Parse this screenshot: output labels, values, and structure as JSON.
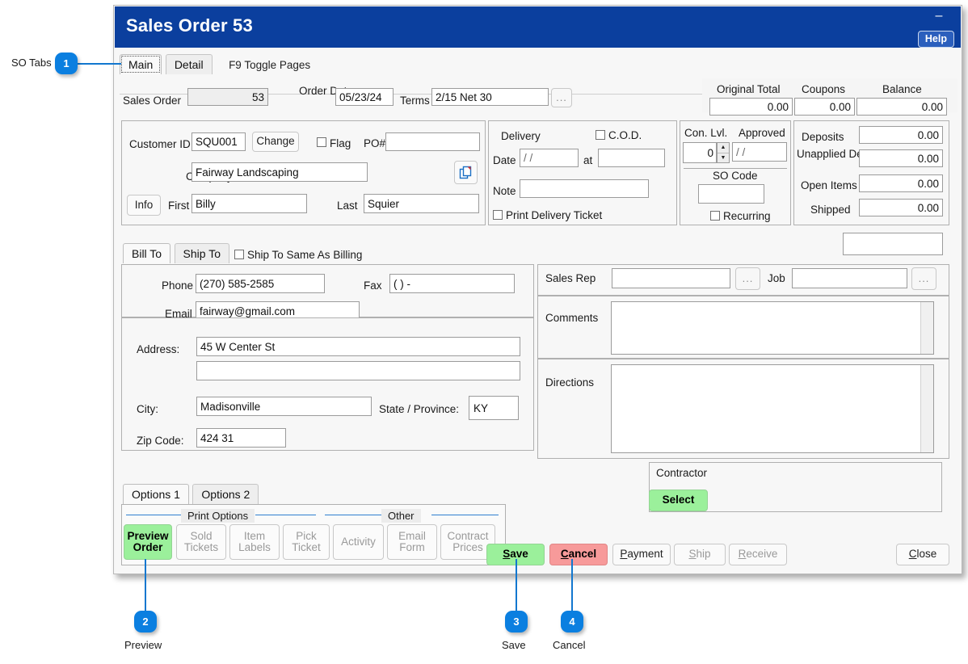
{
  "window": {
    "title": "Sales Order 53",
    "minimize_label": "–",
    "help_label": "Help"
  },
  "tabs": {
    "items": [
      {
        "label": "Main",
        "active": true
      },
      {
        "label": "Detail",
        "active": false
      }
    ],
    "hint": "F9 Toggle Pages"
  },
  "header": {
    "sales_order_label": "Sales Order",
    "sales_order_value": "53",
    "order_date_label": "Order Date",
    "order_date_value": "05/23/24",
    "terms_label": "Terms",
    "terms_value": "2/15 Net 30",
    "terms_browse_label": "...",
    "totals": [
      {
        "label": "Original Total",
        "value": "0.00"
      },
      {
        "label": "Coupons",
        "value": "0.00"
      },
      {
        "label": "Balance",
        "value": "0.00"
      }
    ]
  },
  "customer": {
    "customer_id_label": "Customer ID",
    "customer_id_value": "SQU001",
    "change_label": "Change",
    "flag_label": "Flag",
    "flag_checked": false,
    "po_label": "PO#",
    "po_value": "",
    "company_label": "Company",
    "company_value": "Fairway Landscaping",
    "copy_icon": "copy-icon",
    "info_label": "Info",
    "first_label": "First",
    "first_value": "Billy",
    "last_label": "Last",
    "last_value": "Squier"
  },
  "delivery": {
    "title": "Delivery",
    "cod_label": "C.O.D.",
    "cod_checked": false,
    "date_label": "Date",
    "date_value": "/  /",
    "at_label": "at",
    "at_value": "",
    "note_label": "Note",
    "note_value": "",
    "print_ticket_label": "Print Delivery Ticket",
    "print_ticket_checked": false
  },
  "control": {
    "con_lvl_label": "Con. Lvl.",
    "con_lvl_value": "0",
    "approved_label": "Approved",
    "approved_value": "/  /",
    "so_code_label": "SO Code",
    "so_code_value": "",
    "recurring_label": "Recurring",
    "recurring_checked": false
  },
  "amounts": [
    {
      "label": "Deposits",
      "value": "0.00"
    },
    {
      "label": "Unapplied Deposits",
      "value": "0.00"
    },
    {
      "label": "Open Items",
      "value": "0.00"
    },
    {
      "label": "Shipped",
      "value": "0.00"
    }
  ],
  "status_dropdown": {
    "value": "",
    "icon": "chevron-down-icon"
  },
  "billship": {
    "tabs": [
      {
        "label": "Bill To",
        "active": true
      },
      {
        "label": "Ship To",
        "active": false
      }
    ],
    "same_as_billing_label": "Ship To Same As Billing",
    "same_as_billing_checked": false,
    "phone_label": "Phone",
    "phone_value": "(270) 585-2585",
    "fax_label": "Fax",
    "fax_value": "(    )      -",
    "email_label": "Email",
    "email_value": "fairway@gmail.com",
    "address_label": "Address:",
    "address_value": "45 W Center St",
    "address2_value": "",
    "city_label": "City:",
    "city_value": "Madisonville",
    "state_label": "State / Province:",
    "state_value": "KY",
    "state_icon": "chevron-down-icon",
    "zip_label": "Zip Code:",
    "zip_value": "424 31"
  },
  "rightpanel": {
    "sales_rep_label": "Sales Rep",
    "sales_rep_value": "",
    "sales_rep_browse_label": "...",
    "job_label": "Job",
    "job_value": "",
    "job_browse_label": "...",
    "comments_label": "Comments",
    "comments_value": "",
    "directions_label": "Directions",
    "directions_value": ""
  },
  "contractor": {
    "title": "Contractor",
    "select_label": "Select"
  },
  "options": {
    "tabs": [
      {
        "label": "Options 1",
        "active": true
      },
      {
        "label": "Options 2",
        "active": false
      }
    ],
    "groups": [
      {
        "caption": "Print Options"
      },
      {
        "caption": "Other"
      }
    ],
    "buttons": [
      {
        "line1": "Preview",
        "line2": "Order",
        "state": "green"
      },
      {
        "line1": "Sold",
        "line2": "Tickets",
        "state": "disabled"
      },
      {
        "line1": "Item",
        "line2": "Labels",
        "state": "disabled"
      },
      {
        "line1": "Pick",
        "line2": "Ticket",
        "state": "disabled"
      },
      {
        "line1": "Activity",
        "line2": "",
        "state": "disabled"
      },
      {
        "line1": "Email",
        "line2": "Form",
        "state": "disabled"
      },
      {
        "line1": "Contract",
        "line2": "Prices",
        "state": "disabled"
      }
    ]
  },
  "actions": [
    {
      "accel": "S",
      "rest": "ave",
      "state": "green"
    },
    {
      "accel": "C",
      "rest": "ancel",
      "state": "red"
    },
    {
      "accel": "P",
      "rest": "ayment",
      "state": "normal"
    },
    {
      "accel": "S",
      "rest": "hip",
      "state": "disabled"
    },
    {
      "accel": "R",
      "rest": "eceive",
      "state": "disabled"
    },
    {
      "accel": "C",
      "rest": "lose",
      "state": "normal"
    }
  ],
  "callouts": [
    {
      "number": "1",
      "label": "SO Tabs"
    },
    {
      "number": "2",
      "label": "Preview"
    },
    {
      "number": "3",
      "label": "Save"
    },
    {
      "number": "4",
      "label": "Cancel"
    }
  ],
  "colors": {
    "title_bar": "#0b3f9e",
    "callout_blue": "#0b7fe0",
    "green_button": "#9bf09b",
    "red_button": "#f79a9a",
    "separator_blue": "#2f7fd0"
  }
}
